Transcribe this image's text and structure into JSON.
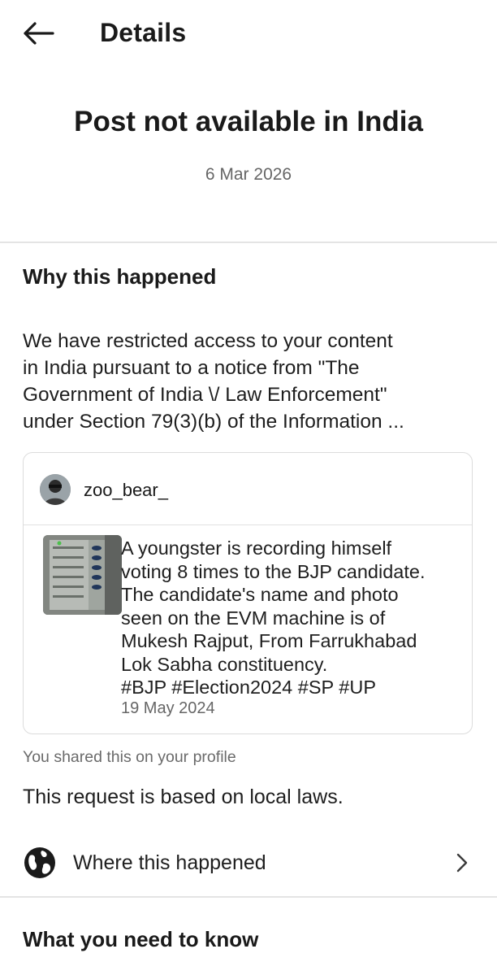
{
  "header": {
    "title": "Details",
    "back_icon": "arrow-left-icon"
  },
  "notice": {
    "headline": "Post not available in India",
    "date": "6 Mar 2026"
  },
  "why": {
    "heading": "Why this happened",
    "body_lines": [
      "We have restricted access to your content",
      "in India pursuant to a notice from \"The",
      "Government of India \\/ Law Enforcement\"",
      "under Section 79(3)(b) of the Information ..."
    ]
  },
  "post": {
    "username": "zoo_bear_",
    "text_lines": [
      "A youngster is recording himself",
      "voting 8 times to the BJP candidate.",
      "The candidate's name and photo",
      "seen on the EVM machine is of",
      "Mukesh Rajput, From Farrukhabad",
      "Lok Sabha constituency.",
      "#BJP #Election2024 #SP #UP"
    ],
    "date": "19 May 2024"
  },
  "shared_note": "You shared this on your profile",
  "local_laws": "This request is based on local laws.",
  "where": {
    "label": "Where this happened",
    "icon": "globe-icon",
    "chevron_icon": "chevron-right-icon"
  },
  "need_to_know": {
    "heading": "What you need to know"
  },
  "colors": {
    "text_primary": "#1a1a1a",
    "text_secondary": "#666666",
    "divider": "#e4e4e4"
  }
}
